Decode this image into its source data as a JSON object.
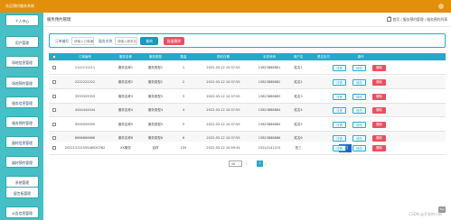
{
  "app": {
    "title": "先远预约服务系统"
  },
  "sidebar": {
    "items": [
      {
        "label": "个人中心"
      },
      {
        "label": "用户管理"
      },
      {
        "label": "场地信息管理"
      },
      {
        "label": "场地预约管理"
      },
      {
        "label": "服务信息管理"
      },
      {
        "label": "服务预约管理"
      },
      {
        "label": "器材信息管理"
      },
      {
        "label": "器材预约管理"
      },
      {
        "label": "系统管理"
      },
      {
        "label": "留言板管理"
      },
      {
        "label": "公告信息管理"
      }
    ]
  },
  "header": {
    "section": "服务预约管理",
    "breadcrumb": "首页 / 服务预约管理 / 服务预约列表"
  },
  "search": {
    "label1": "订单编号",
    "placeholder1": "请输入订单编号",
    "label2": "服务名称",
    "placeholder2": "请输入服务名称",
    "query_btn": "查询",
    "delete_btn": "批量删除"
  },
  "table": {
    "columns": [
      "订单编号",
      "服务名称",
      "服务类型",
      "数量",
      "预约日期",
      "手机号码",
      "用户名",
      "是否支付",
      "操作"
    ],
    "rows": [
      {
        "order": "1111111111",
        "name": "服务名称1",
        "type": "服务类型1",
        "qty": "1",
        "date": "2022-03-12 10:37:55",
        "phone": "13823888881",
        "user": "姓名1"
      },
      {
        "order": "2222222222",
        "name": "服务名称2",
        "type": "服务类型2",
        "qty": "2",
        "date": "2022-03-12 10:37:55",
        "phone": "13823888882",
        "user": "姓名2"
      },
      {
        "order": "3333333333",
        "name": "服务名称3",
        "type": "服务类型3",
        "qty": "3",
        "date": "2022-03-12 10:37:55",
        "phone": "13823888883",
        "user": "姓名3"
      },
      {
        "order": "4444444444",
        "name": "服务名称4",
        "type": "服务类型4",
        "qty": "4",
        "date": "2022-03-12 10:37:55",
        "phone": "13823888884",
        "user": "姓名4"
      },
      {
        "order": "5555555555",
        "name": "服务名称5",
        "type": "服务类型5",
        "qty": "5",
        "date": "2022-03-12 10:37:55",
        "phone": "13823888885",
        "user": "姓名5"
      },
      {
        "order": "6666666666",
        "name": "服务名称6",
        "type": "服务类型6",
        "qty": "6",
        "date": "2022-03-12 10:37:55",
        "phone": "13823888886",
        "user": "姓名6"
      },
      {
        "order": "20221312155548520782",
        "name": "XX服务",
        "type": "血样",
        "qty": "155",
        "date": "2022-03-12 10:59:34",
        "phone": "15212141215",
        "user": "张三",
        "pay": "支付"
      }
    ],
    "actions": {
      "detail": "详情",
      "edit": "修改",
      "delete": "删除"
    }
  },
  "pager": {
    "size": "10",
    "page": "1",
    "prev": "‹",
    "next": "›"
  },
  "watermark": "CSDN @开发的小男",
  "top_button": "Top",
  "colors": {
    "topbar": "#e28f09",
    "sidebar": "#46c0c6",
    "accent": "#2aa6c7",
    "danger": "#e7505f",
    "pay": "#1a64c8"
  }
}
